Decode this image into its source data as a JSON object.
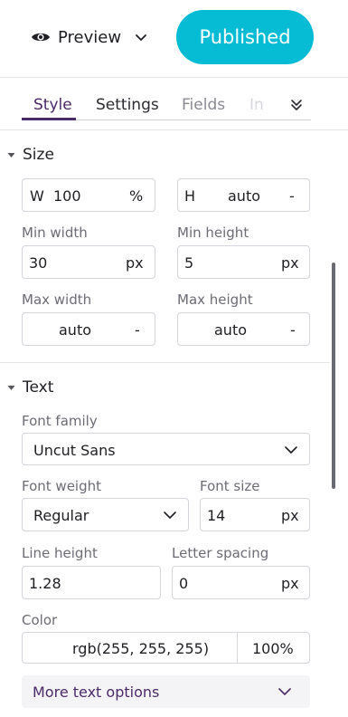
{
  "header": {
    "preview_label": "Preview",
    "publish_label": "Published",
    "publish_color": "#06bcd4"
  },
  "tabs": [
    {
      "label": "Style",
      "active": true
    },
    {
      "label": "Settings"
    },
    {
      "label": "Fields"
    },
    {
      "label": "In"
    }
  ],
  "tabs_more_icon": "double-chevron-down-icon",
  "size": {
    "title": "Size",
    "width": {
      "prefix": "W",
      "value": "100",
      "unit": "%"
    },
    "height": {
      "prefix": "H",
      "value": "auto",
      "unit": "-"
    },
    "min_width": {
      "label": "Min width",
      "value": "30",
      "unit": "px"
    },
    "min_height": {
      "label": "Min height",
      "value": "5",
      "unit": "px"
    },
    "max_width": {
      "label": "Max width",
      "value": "auto",
      "unit": "-"
    },
    "max_height": {
      "label": "Max height",
      "value": "auto",
      "unit": "-"
    }
  },
  "text": {
    "title": "Text",
    "font_family": {
      "label": "Font family",
      "value": "Uncut Sans"
    },
    "font_weight": {
      "label": "Font weight",
      "value": "Regular"
    },
    "font_size": {
      "label": "Font size",
      "value": "14",
      "unit": "px"
    },
    "line_height": {
      "label": "Line height",
      "value": "1.28"
    },
    "letter_spacing": {
      "label": "Letter spacing",
      "value": "0",
      "unit": "px"
    },
    "color": {
      "label": "Color",
      "value": "rgb(255, 255, 255)",
      "opacity": "100%"
    },
    "more_label": "More text options"
  },
  "accent_color": "#4b2a68"
}
